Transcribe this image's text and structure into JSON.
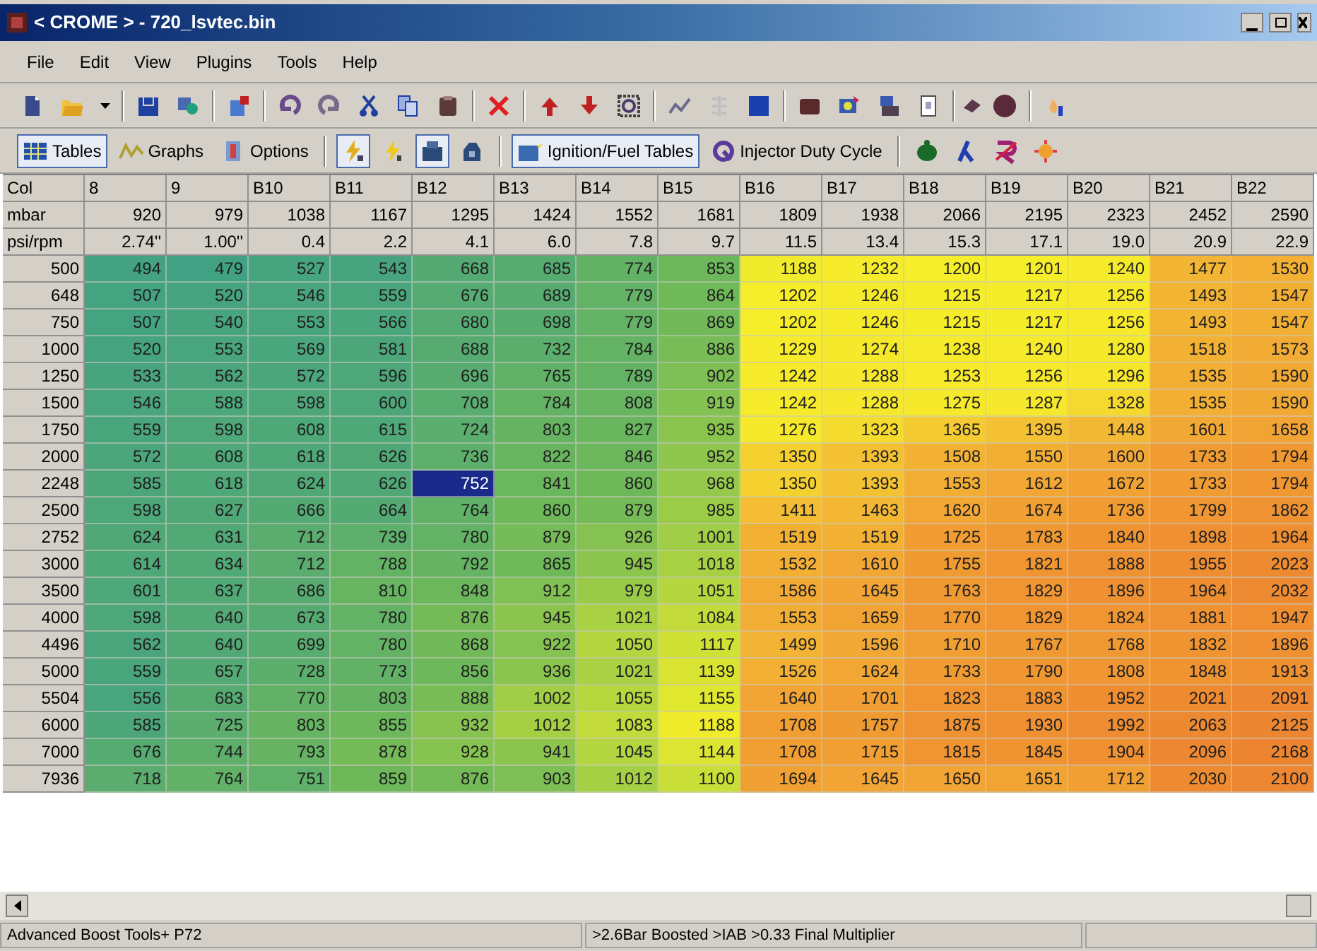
{
  "window": {
    "title": "< CROME > - 720_lsvtec.bin"
  },
  "menu": [
    "File",
    "Edit",
    "View",
    "Plugins",
    "Tools",
    "Help"
  ],
  "toolbar2": [
    {
      "kind": "text",
      "label": "Tables",
      "selected": true
    },
    {
      "kind": "text",
      "label": "Graphs",
      "selected": false
    },
    {
      "kind": "text",
      "label": "Options",
      "selected": false
    },
    {
      "kind": "icon",
      "selected": true
    },
    {
      "kind": "icon",
      "selected": false
    },
    {
      "kind": "icon",
      "selected": true
    },
    {
      "kind": "icon",
      "selected": false
    },
    {
      "kind": "text",
      "label": "Ignition/Fuel Tables",
      "selected": true
    },
    {
      "kind": "text",
      "label": "Injector Duty Cycle",
      "selected": false
    },
    {
      "kind": "icon",
      "selected": false
    },
    {
      "kind": "icon",
      "selected": false
    },
    {
      "kind": "icon",
      "selected": false
    },
    {
      "kind": "icon",
      "selected": false
    }
  ],
  "table": {
    "corner_labels": [
      "Col",
      "mbar",
      "psi/rpm"
    ],
    "columns": [
      "8",
      "9",
      "B10",
      "B11",
      "B12",
      "B13",
      "B14",
      "B15",
      "B16",
      "B17",
      "B18",
      "B19",
      "B20",
      "B21",
      "B22"
    ],
    "mbar": [
      "920",
      "979",
      "1038",
      "1167",
      "1295",
      "1424",
      "1552",
      "1681",
      "1809",
      "1938",
      "2066",
      "2195",
      "2323",
      "2452",
      "2590"
    ],
    "psi": [
      "2.74''",
      "1.00''",
      "0.4",
      "2.2",
      "4.1",
      "6.0",
      "7.8",
      "9.7",
      "11.5",
      "13.4",
      "15.3",
      "17.1",
      "19.0",
      "20.9",
      "22.9"
    ],
    "rows": [
      {
        "rpm": "500",
        "cells": [
          {
            "value": "494",
            "selected": false
          },
          {
            "value": "479",
            "selected": false
          },
          {
            "value": "527",
            "selected": false
          },
          {
            "value": "543",
            "selected": false
          },
          {
            "value": "668",
            "selected": false
          },
          {
            "value": "685",
            "selected": false
          },
          {
            "value": "774",
            "selected": false
          },
          {
            "value": "853",
            "selected": false
          },
          {
            "value": "1188",
            "selected": false
          },
          {
            "value": "1232",
            "selected": false
          },
          {
            "value": "1200",
            "selected": false
          },
          {
            "value": "1201",
            "selected": false
          },
          {
            "value": "1240",
            "selected": false
          },
          {
            "value": "1477",
            "selected": false
          },
          {
            "value": "1530",
            "selected": false
          }
        ]
      },
      {
        "rpm": "648",
        "cells": [
          {
            "value": "507",
            "selected": false
          },
          {
            "value": "520",
            "selected": false
          },
          {
            "value": "546",
            "selected": false
          },
          {
            "value": "559",
            "selected": false
          },
          {
            "value": "676",
            "selected": false
          },
          {
            "value": "689",
            "selected": false
          },
          {
            "value": "779",
            "selected": false
          },
          {
            "value": "864",
            "selected": false
          },
          {
            "value": "1202",
            "selected": false
          },
          {
            "value": "1246",
            "selected": false
          },
          {
            "value": "1215",
            "selected": false
          },
          {
            "value": "1217",
            "selected": false
          },
          {
            "value": "1256",
            "selected": false
          },
          {
            "value": "1493",
            "selected": false
          },
          {
            "value": "1547",
            "selected": false
          }
        ]
      },
      {
        "rpm": "750",
        "cells": [
          {
            "value": "507",
            "selected": false
          },
          {
            "value": "540",
            "selected": false
          },
          {
            "value": "553",
            "selected": false
          },
          {
            "value": "566",
            "selected": false
          },
          {
            "value": "680",
            "selected": false
          },
          {
            "value": "698",
            "selected": false
          },
          {
            "value": "779",
            "selected": false
          },
          {
            "value": "869",
            "selected": false
          },
          {
            "value": "1202",
            "selected": false
          },
          {
            "value": "1246",
            "selected": false
          },
          {
            "value": "1215",
            "selected": false
          },
          {
            "value": "1217",
            "selected": false
          },
          {
            "value": "1256",
            "selected": false
          },
          {
            "value": "1493",
            "selected": false
          },
          {
            "value": "1547",
            "selected": false
          }
        ]
      },
      {
        "rpm": "1000",
        "cells": [
          {
            "value": "520",
            "selected": false
          },
          {
            "value": "553",
            "selected": false
          },
          {
            "value": "569",
            "selected": false
          },
          {
            "value": "581",
            "selected": false
          },
          {
            "value": "688",
            "selected": false
          },
          {
            "value": "732",
            "selected": false
          },
          {
            "value": "784",
            "selected": false
          },
          {
            "value": "886",
            "selected": false
          },
          {
            "value": "1229",
            "selected": false
          },
          {
            "value": "1274",
            "selected": false
          },
          {
            "value": "1238",
            "selected": false
          },
          {
            "value": "1240",
            "selected": false
          },
          {
            "value": "1280",
            "selected": false
          },
          {
            "value": "1518",
            "selected": false
          },
          {
            "value": "1573",
            "selected": false
          }
        ]
      },
      {
        "rpm": "1250",
        "cells": [
          {
            "value": "533",
            "selected": false
          },
          {
            "value": "562",
            "selected": false
          },
          {
            "value": "572",
            "selected": false
          },
          {
            "value": "596",
            "selected": false
          },
          {
            "value": "696",
            "selected": false
          },
          {
            "value": "765",
            "selected": false
          },
          {
            "value": "789",
            "selected": false
          },
          {
            "value": "902",
            "selected": false
          },
          {
            "value": "1242",
            "selected": false
          },
          {
            "value": "1288",
            "selected": false
          },
          {
            "value": "1253",
            "selected": false
          },
          {
            "value": "1256",
            "selected": false
          },
          {
            "value": "1296",
            "selected": false
          },
          {
            "value": "1535",
            "selected": false
          },
          {
            "value": "1590",
            "selected": false
          }
        ]
      },
      {
        "rpm": "1500",
        "cells": [
          {
            "value": "546",
            "selected": false
          },
          {
            "value": "588",
            "selected": false
          },
          {
            "value": "598",
            "selected": false
          },
          {
            "value": "600",
            "selected": false
          },
          {
            "value": "708",
            "selected": false
          },
          {
            "value": "784",
            "selected": false
          },
          {
            "value": "808",
            "selected": false
          },
          {
            "value": "919",
            "selected": false
          },
          {
            "value": "1242",
            "selected": false
          },
          {
            "value": "1288",
            "selected": false
          },
          {
            "value": "1275",
            "selected": false
          },
          {
            "value": "1287",
            "selected": false
          },
          {
            "value": "1328",
            "selected": false
          },
          {
            "value": "1535",
            "selected": false
          },
          {
            "value": "1590",
            "selected": false
          }
        ]
      },
      {
        "rpm": "1750",
        "cells": [
          {
            "value": "559",
            "selected": false
          },
          {
            "value": "598",
            "selected": false
          },
          {
            "value": "608",
            "selected": false
          },
          {
            "value": "615",
            "selected": false
          },
          {
            "value": "724",
            "selected": false
          },
          {
            "value": "803",
            "selected": false
          },
          {
            "value": "827",
            "selected": false
          },
          {
            "value": "935",
            "selected": false
          },
          {
            "value": "1276",
            "selected": false
          },
          {
            "value": "1323",
            "selected": false
          },
          {
            "value": "1365",
            "selected": false
          },
          {
            "value": "1395",
            "selected": false
          },
          {
            "value": "1448",
            "selected": false
          },
          {
            "value": "1601",
            "selected": false
          },
          {
            "value": "1658",
            "selected": false
          }
        ]
      },
      {
        "rpm": "2000",
        "cells": [
          {
            "value": "572",
            "selected": false
          },
          {
            "value": "608",
            "selected": false
          },
          {
            "value": "618",
            "selected": false
          },
          {
            "value": "626",
            "selected": false
          },
          {
            "value": "736",
            "selected": false
          },
          {
            "value": "822",
            "selected": false
          },
          {
            "value": "846",
            "selected": false
          },
          {
            "value": "952",
            "selected": false
          },
          {
            "value": "1350",
            "selected": false
          },
          {
            "value": "1393",
            "selected": false
          },
          {
            "value": "1508",
            "selected": false
          },
          {
            "value": "1550",
            "selected": false
          },
          {
            "value": "1600",
            "selected": false
          },
          {
            "value": "1733",
            "selected": false
          },
          {
            "value": "1794",
            "selected": false
          }
        ]
      },
      {
        "rpm": "2248",
        "cells": [
          {
            "value": "585",
            "selected": false
          },
          {
            "value": "618",
            "selected": false
          },
          {
            "value": "624",
            "selected": false
          },
          {
            "value": "626",
            "selected": false
          },
          {
            "value": "752",
            "selected": true
          },
          {
            "value": "841",
            "selected": false
          },
          {
            "value": "860",
            "selected": false
          },
          {
            "value": "968",
            "selected": false
          },
          {
            "value": "1350",
            "selected": false
          },
          {
            "value": "1393",
            "selected": false
          },
          {
            "value": "1553",
            "selected": false
          },
          {
            "value": "1612",
            "selected": false
          },
          {
            "value": "1672",
            "selected": false
          },
          {
            "value": "1733",
            "selected": false
          },
          {
            "value": "1794",
            "selected": false
          }
        ]
      },
      {
        "rpm": "2500",
        "cells": [
          {
            "value": "598",
            "selected": false
          },
          {
            "value": "627",
            "selected": false
          },
          {
            "value": "666",
            "selected": false
          },
          {
            "value": "664",
            "selected": false
          },
          {
            "value": "764",
            "selected": false
          },
          {
            "value": "860",
            "selected": false
          },
          {
            "value": "879",
            "selected": false
          },
          {
            "value": "985",
            "selected": false
          },
          {
            "value": "1411",
            "selected": false
          },
          {
            "value": "1463",
            "selected": false
          },
          {
            "value": "1620",
            "selected": false
          },
          {
            "value": "1674",
            "selected": false
          },
          {
            "value": "1736",
            "selected": false
          },
          {
            "value": "1799",
            "selected": false
          },
          {
            "value": "1862",
            "selected": false
          }
        ]
      },
      {
        "rpm": "2752",
        "cells": [
          {
            "value": "624",
            "selected": false
          },
          {
            "value": "631",
            "selected": false
          },
          {
            "value": "712",
            "selected": false
          },
          {
            "value": "739",
            "selected": false
          },
          {
            "value": "780",
            "selected": false
          },
          {
            "value": "879",
            "selected": false
          },
          {
            "value": "926",
            "selected": false
          },
          {
            "value": "1001",
            "selected": false
          },
          {
            "value": "1519",
            "selected": false
          },
          {
            "value": "1519",
            "selected": false
          },
          {
            "value": "1725",
            "selected": false
          },
          {
            "value": "1783",
            "selected": false
          },
          {
            "value": "1840",
            "selected": false
          },
          {
            "value": "1898",
            "selected": false
          },
          {
            "value": "1964",
            "selected": false
          }
        ]
      },
      {
        "rpm": "3000",
        "cells": [
          {
            "value": "614",
            "selected": false
          },
          {
            "value": "634",
            "selected": false
          },
          {
            "value": "712",
            "selected": false
          },
          {
            "value": "788",
            "selected": false
          },
          {
            "value": "792",
            "selected": false
          },
          {
            "value": "865",
            "selected": false
          },
          {
            "value": "945",
            "selected": false
          },
          {
            "value": "1018",
            "selected": false
          },
          {
            "value": "1532",
            "selected": false
          },
          {
            "value": "1610",
            "selected": false
          },
          {
            "value": "1755",
            "selected": false
          },
          {
            "value": "1821",
            "selected": false
          },
          {
            "value": "1888",
            "selected": false
          },
          {
            "value": "1955",
            "selected": false
          },
          {
            "value": "2023",
            "selected": false
          }
        ]
      },
      {
        "rpm": "3500",
        "cells": [
          {
            "value": "601",
            "selected": false
          },
          {
            "value": "637",
            "selected": false
          },
          {
            "value": "686",
            "selected": false
          },
          {
            "value": "810",
            "selected": false
          },
          {
            "value": "848",
            "selected": false
          },
          {
            "value": "912",
            "selected": false
          },
          {
            "value": "979",
            "selected": false
          },
          {
            "value": "1051",
            "selected": false
          },
          {
            "value": "1586",
            "selected": false
          },
          {
            "value": "1645",
            "selected": false
          },
          {
            "value": "1763",
            "selected": false
          },
          {
            "value": "1829",
            "selected": false
          },
          {
            "value": "1896",
            "selected": false
          },
          {
            "value": "1964",
            "selected": false
          },
          {
            "value": "2032",
            "selected": false
          }
        ]
      },
      {
        "rpm": "4000",
        "cells": [
          {
            "value": "598",
            "selected": false
          },
          {
            "value": "640",
            "selected": false
          },
          {
            "value": "673",
            "selected": false
          },
          {
            "value": "780",
            "selected": false
          },
          {
            "value": "876",
            "selected": false
          },
          {
            "value": "945",
            "selected": false
          },
          {
            "value": "1021",
            "selected": false
          },
          {
            "value": "1084",
            "selected": false
          },
          {
            "value": "1553",
            "selected": false
          },
          {
            "value": "1659",
            "selected": false
          },
          {
            "value": "1770",
            "selected": false
          },
          {
            "value": "1829",
            "selected": false
          },
          {
            "value": "1824",
            "selected": false
          },
          {
            "value": "1881",
            "selected": false
          },
          {
            "value": "1947",
            "selected": false
          }
        ]
      },
      {
        "rpm": "4496",
        "cells": [
          {
            "value": "562",
            "selected": false
          },
          {
            "value": "640",
            "selected": false
          },
          {
            "value": "699",
            "selected": false
          },
          {
            "value": "780",
            "selected": false
          },
          {
            "value": "868",
            "selected": false
          },
          {
            "value": "922",
            "selected": false
          },
          {
            "value": "1050",
            "selected": false
          },
          {
            "value": "1117",
            "selected": false
          },
          {
            "value": "1499",
            "selected": false
          },
          {
            "value": "1596",
            "selected": false
          },
          {
            "value": "1710",
            "selected": false
          },
          {
            "value": "1767",
            "selected": false
          },
          {
            "value": "1768",
            "selected": false
          },
          {
            "value": "1832",
            "selected": false
          },
          {
            "value": "1896",
            "selected": false
          }
        ]
      },
      {
        "rpm": "5000",
        "cells": [
          {
            "value": "559",
            "selected": false
          },
          {
            "value": "657",
            "selected": false
          },
          {
            "value": "728",
            "selected": false
          },
          {
            "value": "773",
            "selected": false
          },
          {
            "value": "856",
            "selected": false
          },
          {
            "value": "936",
            "selected": false
          },
          {
            "value": "1021",
            "selected": false
          },
          {
            "value": "1139",
            "selected": false
          },
          {
            "value": "1526",
            "selected": false
          },
          {
            "value": "1624",
            "selected": false
          },
          {
            "value": "1733",
            "selected": false
          },
          {
            "value": "1790",
            "selected": false
          },
          {
            "value": "1808",
            "selected": false
          },
          {
            "value": "1848",
            "selected": false
          },
          {
            "value": "1913",
            "selected": false
          }
        ]
      },
      {
        "rpm": "5504",
        "cells": [
          {
            "value": "556",
            "selected": false
          },
          {
            "value": "683",
            "selected": false
          },
          {
            "value": "770",
            "selected": false
          },
          {
            "value": "803",
            "selected": false
          },
          {
            "value": "888",
            "selected": false
          },
          {
            "value": "1002",
            "selected": false
          },
          {
            "value": "1055",
            "selected": false
          },
          {
            "value": "1155",
            "selected": false
          },
          {
            "value": "1640",
            "selected": false
          },
          {
            "value": "1701",
            "selected": false
          },
          {
            "value": "1823",
            "selected": false
          },
          {
            "value": "1883",
            "selected": false
          },
          {
            "value": "1952",
            "selected": false
          },
          {
            "value": "2021",
            "selected": false
          },
          {
            "value": "2091",
            "selected": false
          }
        ]
      },
      {
        "rpm": "6000",
        "cells": [
          {
            "value": "585",
            "selected": false
          },
          {
            "value": "725",
            "selected": false
          },
          {
            "value": "803",
            "selected": false
          },
          {
            "value": "855",
            "selected": false
          },
          {
            "value": "932",
            "selected": false
          },
          {
            "value": "1012",
            "selected": false
          },
          {
            "value": "1083",
            "selected": false
          },
          {
            "value": "1188",
            "selected": false
          },
          {
            "value": "1708",
            "selected": false
          },
          {
            "value": "1757",
            "selected": false
          },
          {
            "value": "1875",
            "selected": false
          },
          {
            "value": "1930",
            "selected": false
          },
          {
            "value": "1992",
            "selected": false
          },
          {
            "value": "2063",
            "selected": false
          },
          {
            "value": "2125",
            "selected": false
          }
        ]
      },
      {
        "rpm": "7000",
        "cells": [
          {
            "value": "676",
            "selected": false
          },
          {
            "value": "744",
            "selected": false
          },
          {
            "value": "793",
            "selected": false
          },
          {
            "value": "878",
            "selected": false
          },
          {
            "value": "928",
            "selected": false
          },
          {
            "value": "941",
            "selected": false
          },
          {
            "value": "1045",
            "selected": false
          },
          {
            "value": "1144",
            "selected": false
          },
          {
            "value": "1708",
            "selected": false
          },
          {
            "value": "1715",
            "selected": false
          },
          {
            "value": "1815",
            "selected": false
          },
          {
            "value": "1845",
            "selected": false
          },
          {
            "value": "1904",
            "selected": false
          },
          {
            "value": "2096",
            "selected": false
          },
          {
            "value": "2168",
            "selected": false
          }
        ]
      },
      {
        "rpm": "7936",
        "cells": [
          {
            "value": "718",
            "selected": false
          },
          {
            "value": "764",
            "selected": false
          },
          {
            "value": "751",
            "selected": false
          },
          {
            "value": "859",
            "selected": false
          },
          {
            "value": "876",
            "selected": false
          },
          {
            "value": "903",
            "selected": false
          },
          {
            "value": "1012",
            "selected": false
          },
          {
            "value": "1100",
            "selected": false
          },
          {
            "value": "1694",
            "selected": false
          },
          {
            "value": "1645",
            "selected": false
          },
          {
            "value": "1650",
            "selected": false
          },
          {
            "value": "1651",
            "selected": false
          },
          {
            "value": "1712",
            "selected": false
          },
          {
            "value": "2030",
            "selected": false
          },
          {
            "value": "2100",
            "selected": false
          }
        ]
      }
    ]
  },
  "status_bar": [
    "Advanced Boost Tools+ P72",
    ">2.6Bar Boosted >IAB >0.33 Final Multiplier"
  ]
}
